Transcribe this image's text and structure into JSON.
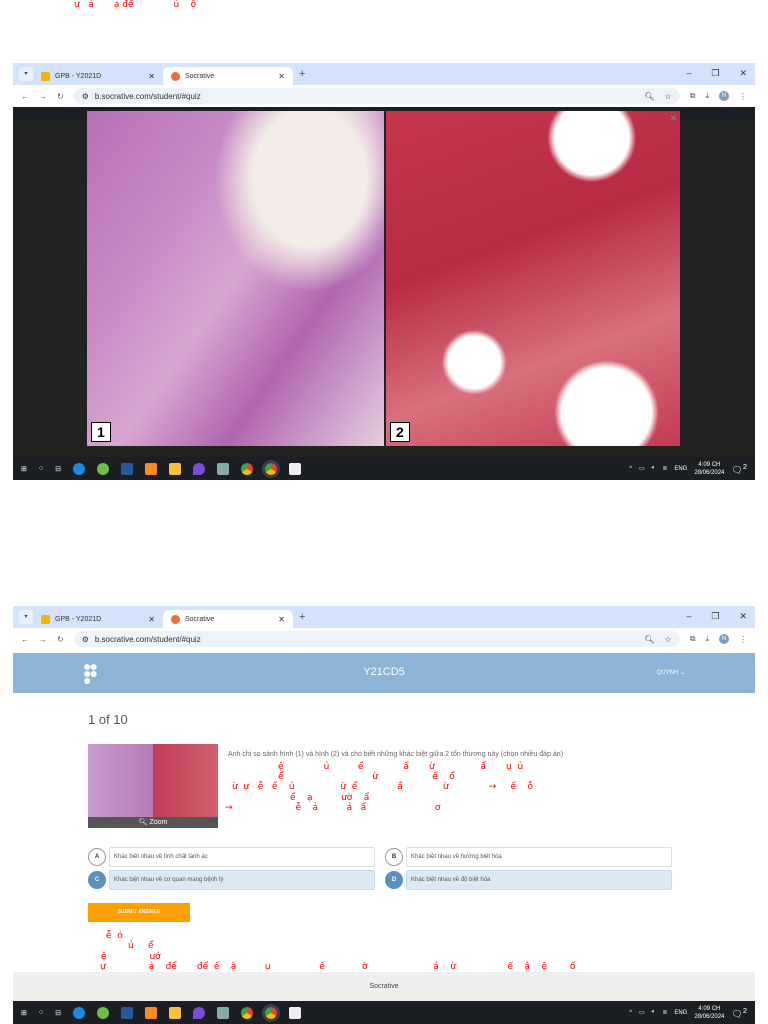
{
  "browser": {
    "tabs": [
      {
        "label": "GPB - Y2021D"
      },
      {
        "label": "Socrative"
      }
    ],
    "url": "b.socrative.com/student/#quiz",
    "profile_initial": "N"
  },
  "viewer": {
    "image_labels": [
      "1",
      "2"
    ],
    "close": "×"
  },
  "taskbar": {
    "lang": "ENG",
    "time": "4:09 CH",
    "date": "28/06/2024",
    "notifications": "2"
  },
  "app": {
    "class_name": "Y21CD5",
    "user": "QUYNH",
    "progress": "1 of 10",
    "zoom_label": "Zoom",
    "question": "Anh chị so sánh hình (1) và hình (2) và cho biết những khác biệt giữa 2 tổn thương này (chọn nhiều đáp án)",
    "options": [
      {
        "letter": "A",
        "text": "Khác biệt nhau về tính chất lành ác",
        "selected": false
      },
      {
        "letter": "B",
        "text": "Khác biệt nhau về hướng biệt hóa",
        "selected": false
      },
      {
        "letter": "C",
        "text": "Khác biệt nhau về cơ quan mang bệnh lý",
        "selected": true
      },
      {
        "letter": "D",
        "text": "Khác biệt nhau về độ biệt hóa",
        "selected": true
      }
    ],
    "submit": "SUBMIT ANSWER",
    "footer": "Socrative"
  },
  "stray_glyphs": [
    "ự   ả       ạ để              ủ    ộ",
    "ệ              ủ          ể              ẩ       ừ                ẩ       ụ  ủ",
    "ể                               ừ                   ế    ổ",
    "ừ  ự   ễ   ế    ủ                ừ  ể              ẩ              ừ              →     ế    ỗ",
    "ể    ạ          ườ    ẩ",
    "→                      ễ    ả          ả   ẩ                        ơ",
    "ễ  ỏ",
    "ủ     ể",
    "ệ               ướ",
    "ự               ả    để       để  ế    ậ          ụ                 ế             ờ                       ả    ừ                  ế    ậ    ệ        ố"
  ]
}
